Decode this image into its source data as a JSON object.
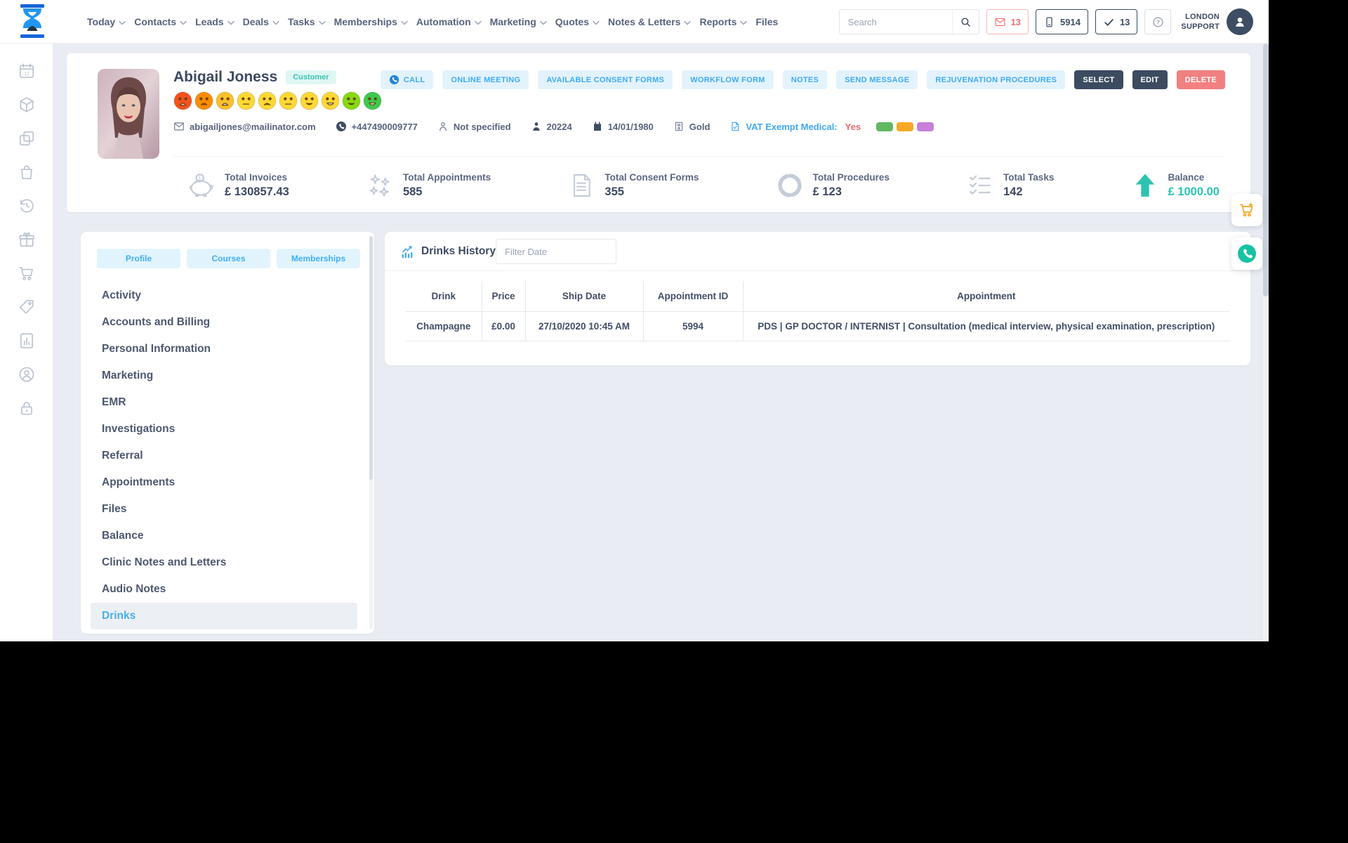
{
  "nav": {
    "items": [
      {
        "label": "Today",
        "chevron": true
      },
      {
        "label": "Contacts",
        "chevron": true
      },
      {
        "label": "Leads",
        "chevron": true
      },
      {
        "label": "Deals",
        "chevron": true
      },
      {
        "label": "Tasks",
        "chevron": true
      },
      {
        "label": "Memberships",
        "chevron": true
      },
      {
        "label": "Automation",
        "chevron": true
      },
      {
        "label": "Marketing",
        "chevron": true
      },
      {
        "label": "Quotes",
        "chevron": true
      },
      {
        "label": "Notes & Letters",
        "chevron": true
      },
      {
        "label": "Reports",
        "chevron": true
      },
      {
        "label": "Files",
        "chevron": false
      }
    ],
    "search_placeholder": "Search",
    "badges": {
      "messages": "13",
      "phone": "5914",
      "done": "13"
    },
    "account": {
      "line1": "LONDON",
      "line2": "SUPPORT"
    }
  },
  "client": {
    "name": "Abigail Joness",
    "type_badge": "Customer",
    "email": "abigailjones@mailinator.com",
    "phone": "+447490009777",
    "gender": "Not specified",
    "id": "20224",
    "dob": "14/01/1980",
    "tier": "Gold",
    "vat_label": "VAT Exempt Medical:",
    "vat_value": "Yes",
    "swatches": [
      "#61b861",
      "#f9a825",
      "#c77fd9"
    ],
    "mood": [
      {
        "color": "#f4511e",
        "mouth": "open-frown"
      },
      {
        "color": "#fb8c00",
        "mouth": "frown"
      },
      {
        "color": "#fbc02d",
        "mouth": "open-frown"
      },
      {
        "color": "#fdd835",
        "mouth": "flat"
      },
      {
        "color": "#fdd835",
        "mouth": "frown"
      },
      {
        "color": "#fdd835",
        "mouth": "flat"
      },
      {
        "color": "#fdd835",
        "mouth": "smile"
      },
      {
        "color": "#fdd835",
        "mouth": "grin"
      },
      {
        "color": "#86d912",
        "mouth": "smile"
      },
      {
        "color": "#3fc84e",
        "mouth": "grin"
      }
    ],
    "actions": [
      {
        "label": "CALL",
        "style": "light",
        "icon": "call-icon"
      },
      {
        "label": "ONLINE MEETING",
        "style": "light"
      },
      {
        "label": "AVAILABLE CONSENT FORMS",
        "style": "light"
      },
      {
        "label": "WORKFLOW FORM",
        "style": "light"
      },
      {
        "label": "NOTES",
        "style": "light"
      },
      {
        "label": "SEND MESSAGE",
        "style": "light"
      },
      {
        "label": "REJUVENATION PROCEDURES",
        "style": "light"
      },
      {
        "label": "SELECT",
        "style": "dark"
      },
      {
        "label": "EDIT",
        "style": "dark"
      },
      {
        "label": "DELETE",
        "style": "danger"
      }
    ]
  },
  "stats": [
    {
      "icon": "piggy-bank-icon",
      "label": "Total Invoices",
      "value": "£ 130857.43"
    },
    {
      "icon": "sparkles-icon",
      "label": "Total Appointments",
      "value": "585"
    },
    {
      "icon": "consent-form-icon",
      "label": "Total Consent Forms",
      "value": "355"
    },
    {
      "icon": "donut-chart-icon",
      "label": "Total Procedures",
      "value": "£ 123"
    },
    {
      "icon": "tasks-icon",
      "label": "Total Tasks",
      "value": "142"
    },
    {
      "icon": "arrow-up-icon",
      "label": "Balance",
      "value": "£ 1000.00",
      "accent": true
    }
  ],
  "sidebar_icons": [
    "calendar-date-icon",
    "cube-icon",
    "copy-icon",
    "shopping-bag-icon",
    "history-icon",
    "gift-icon",
    "cart-icon",
    "price-tag-icon",
    "report-file-icon",
    "user-circle-icon",
    "lock-icon"
  ],
  "left_panel": {
    "tabs": [
      "Profile",
      "Courses",
      "Memberships"
    ],
    "items": [
      "Activity",
      "Accounts and Billing",
      "Personal Information",
      "Marketing",
      "EMR",
      "Investigations",
      "Referral",
      "Appointments",
      "Files",
      "Balance",
      "Clinic Notes and Letters",
      "Audio Notes",
      "Drinks"
    ],
    "selected": "Drinks"
  },
  "main": {
    "title": "Drinks History",
    "filter_placeholder": "Filter Date",
    "table": {
      "headers": [
        "Drink",
        "Price",
        "Ship Date",
        "Appointment ID",
        "Appointment"
      ],
      "rows": [
        [
          "Champagne",
          "£0.00",
          "27/10/2020 10:45 AM",
          "5994",
          "PDS | GP DOCTOR / INTERNIST | Consultation (medical interview, physical examination, prescription)"
        ]
      ]
    }
  }
}
